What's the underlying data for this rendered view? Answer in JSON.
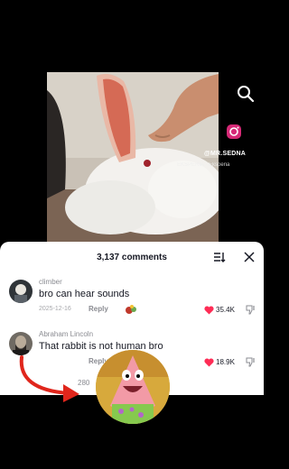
{
  "video": {
    "handle": "@MR.SEDNA",
    "sub_watermark": "EKSPERIA · Eksperia"
  },
  "comments_panel": {
    "count_label": "3,137 comments",
    "comments": [
      {
        "username": "climber",
        "text": "bro can hear sounds",
        "date": "2025-12-16",
        "reply_label": "Reply",
        "likes": "35.4K"
      },
      {
        "username": "Abraham Lincoln",
        "text": "That rabbit is not human bro",
        "reply_label": "Reply",
        "likes": "18.9K"
      }
    ],
    "partial_text": "280"
  },
  "colors": {
    "heart": "#fe2c55",
    "arrow": "#e0261c",
    "text_primary": "#161823",
    "text_secondary": "#8a8b91"
  },
  "icons": [
    "search-icon",
    "instagram-icon",
    "sort-icon",
    "close-icon",
    "heart-icon",
    "dislike-icon",
    "emoji-icon"
  ]
}
